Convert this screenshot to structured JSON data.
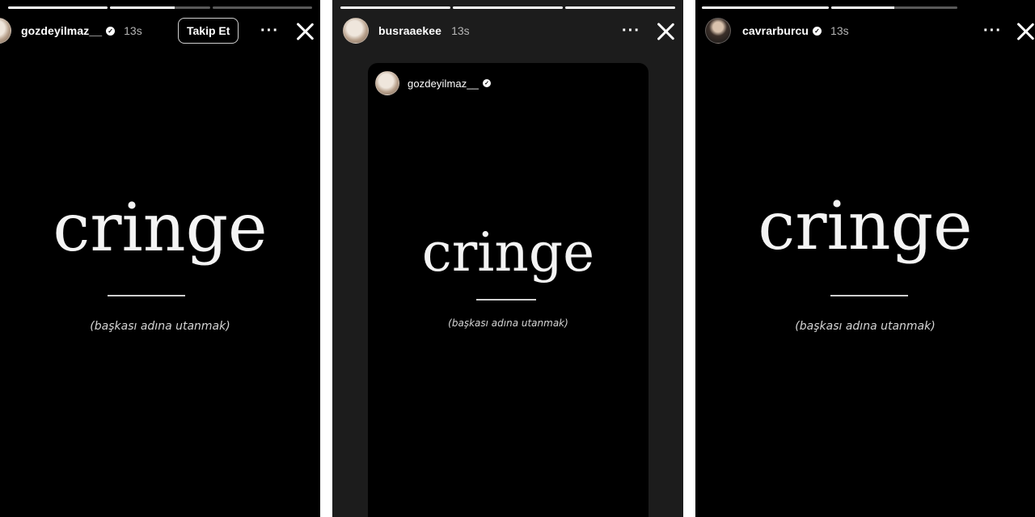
{
  "panels": [
    {
      "username": "gozdeyilmaz__",
      "time": "13s",
      "follow_label": "Takip Et",
      "more_label": "···",
      "word": "cringe",
      "caption": "(başkası adına utanmak)",
      "progress": [
        1.0,
        0.65,
        0.0
      ]
    },
    {
      "username": "busraaekee",
      "time": "13s",
      "more_label": "···",
      "shared_card": {
        "username": "gozdeyilmaz__",
        "word": "cringe",
        "caption": "(başkası adına utanmak)"
      },
      "progress": [
        1.0,
        1.0,
        1.0
      ]
    },
    {
      "username": "cavrarburcu",
      "time": "13s",
      "more_label": "···",
      "word": "cringe",
      "caption": "(başkası adına utanmak)",
      "progress": [
        1.0,
        0.5
      ]
    }
  ],
  "icons": [
    "avatar",
    "verified-icon",
    "more-icon",
    "close-icon"
  ],
  "colors": {
    "background": "#000000",
    "text": "#ffffff",
    "muted": "#b5b5b5"
  }
}
